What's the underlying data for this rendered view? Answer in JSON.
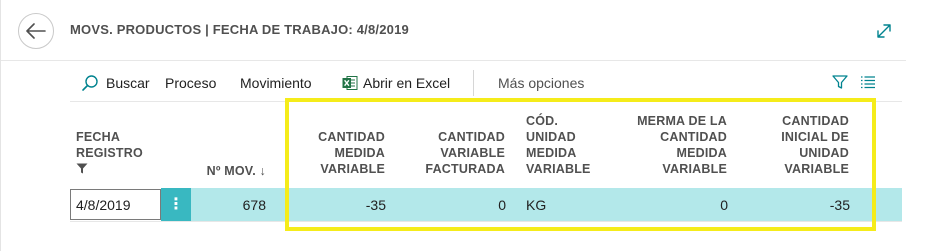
{
  "header": {
    "title": "MOVS. PRODUCTOS | FECHA DE TRABAJO: 4/8/2019"
  },
  "actions": {
    "search": "Buscar",
    "proceso": "Proceso",
    "movimiento": "Movimiento",
    "excel": "Abrir en Excel",
    "more": "Más opciones"
  },
  "columns": {
    "fecha_registro": "FECHA REGISTRO",
    "n_mov": "Nº MOV. ↓",
    "cantidad_medida_variable": "CANTIDAD MEDIDA VARIABLE",
    "cantidad_variable_facturada": "CANTIDAD VARIABLE FACTURADA",
    "cod_unidad_medida_variable": "CÓD. UNIDAD MEDIDA VARIABLE",
    "merma_cantidad_medida_variable": "MERMA DE LA CANTIDAD MEDIDA VARIABLE",
    "cantidad_inicial_unidad_variable": "CANTIDAD INICIAL DE UNIDAD VARIABLE"
  },
  "rows": [
    {
      "fecha_registro": "4/8/2019",
      "menu": "⋮",
      "n_mov": "678",
      "cantidad_medida_variable": "-35",
      "cantidad_variable_facturada": "0",
      "cod_unidad_medida_variable": "KG",
      "merma_cantidad_medida_variable": "0",
      "cantidad_inicial_unidad_variable": "-35"
    }
  ],
  "colors": {
    "row_selected": "#b3e8ea",
    "menu_cell": "#39b8c1",
    "accent": "#00838f",
    "excel": "#217346",
    "highlight": "#f5ec1a"
  },
  "icons": {
    "back": "arrow-left-icon",
    "expand": "expand-diagonal-icon",
    "search": "search-icon",
    "excel": "excel-icon",
    "filter": "filter-icon",
    "list": "list-view-icon"
  }
}
